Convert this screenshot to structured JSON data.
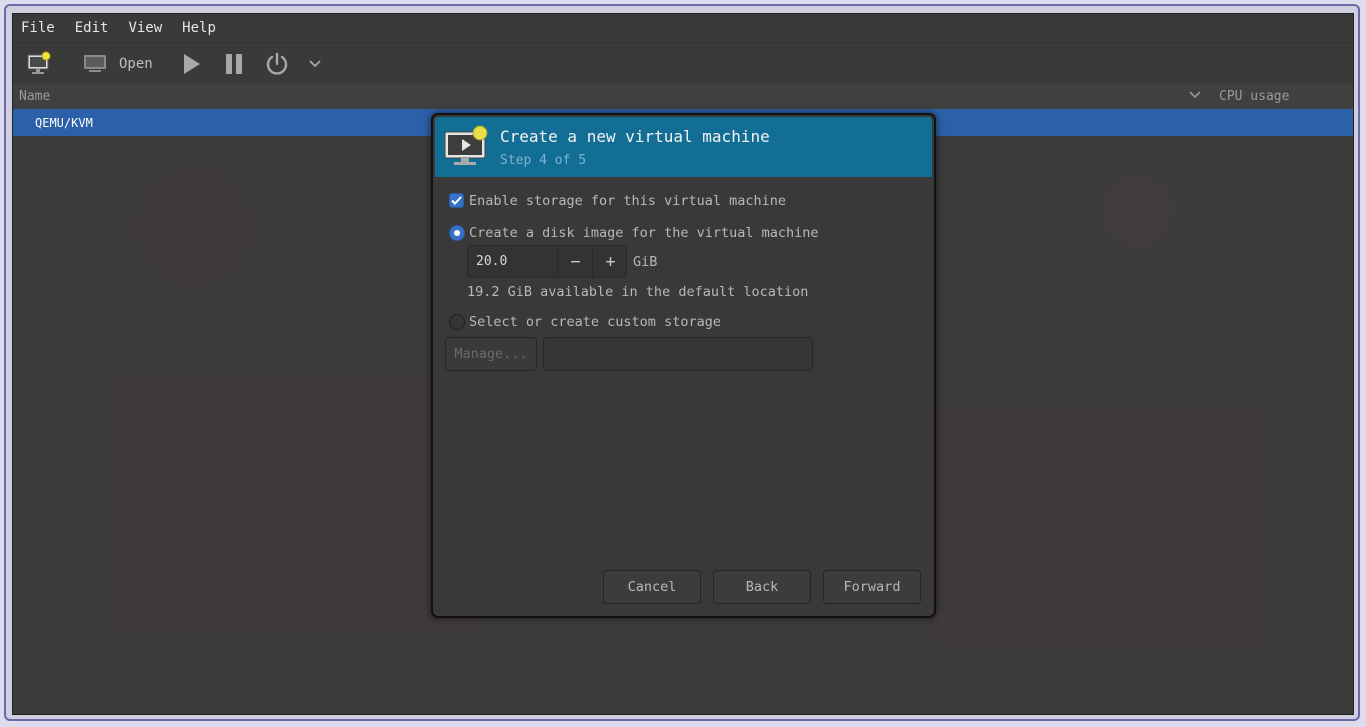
{
  "menubar": {
    "items": [
      "File",
      "Edit",
      "View",
      "Help"
    ]
  },
  "toolbar": {
    "new_vm_icon": "new-vm-icon",
    "open_icon": "monitor-icon",
    "open_label": "Open",
    "run_icon": "play-icon",
    "pause_icon": "pause-icon",
    "shutdown_icon": "power-icon",
    "menu_icon": "chevron-down-icon"
  },
  "list": {
    "columns": {
      "name": "Name",
      "cpu": "CPU usage"
    },
    "rows": [
      {
        "label": "QEMU/KVM",
        "selected": true
      }
    ]
  },
  "dialog": {
    "title": "Create a new virtual machine",
    "step": "Step 4 of 5",
    "enable_storage": {
      "label": "Enable storage for this virtual machine",
      "checked": true
    },
    "disk_image": {
      "label": "Create a disk image for the virtual machine",
      "selected": true
    },
    "size": {
      "value": "20.0",
      "minus": "−",
      "plus": "+",
      "unit": "GiB"
    },
    "available": "19.2 GiB available in the default location",
    "custom_storage": {
      "label": "Select or create custom storage",
      "selected": false
    },
    "manage_label": "Manage...",
    "path_value": "",
    "buttons": {
      "cancel": "Cancel",
      "back": "Back",
      "forward": "Forward"
    }
  },
  "colors": {
    "accent": "#3772c8",
    "header": "#136e95",
    "selection": "#2c60a8"
  }
}
